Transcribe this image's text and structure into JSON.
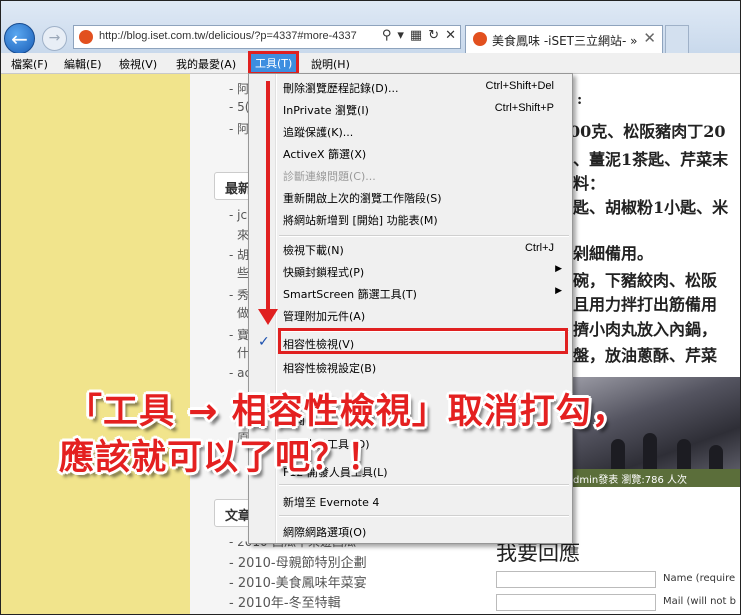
{
  "browser": {
    "url": "http://blog.iset.com.tw/delicious/?p=4337#more-4337",
    "tab_title": "美食鳳味 -iSET三立網站- »"
  },
  "menubar": {
    "items": [
      "檔案(F)",
      "編輯(E)",
      "檢視(V)",
      "我的最愛(A)",
      "工具(T)",
      "說明(H)"
    ],
    "active": "工具(T)"
  },
  "tools_menu": {
    "items": [
      {
        "label": "刪除瀏覽歷程記錄(D)...",
        "shortcut": "Ctrl+Shift+Del"
      },
      {
        "label": "InPrivate 瀏覽(I)",
        "shortcut": "Ctrl+Shift+P"
      },
      {
        "label": "追蹤保護(K)..."
      },
      {
        "label": "ActiveX 篩選(X)"
      },
      {
        "label": "診斷連線問題(C)...",
        "disabled": true
      },
      {
        "label": "重新開啟上次的瀏覽工作階段(S)"
      },
      {
        "label": "將網站新增到 [開始] 功能表(M)"
      },
      {
        "label": "檢視下載(N)",
        "shortcut": "Ctrl+J"
      },
      {
        "label": "快顯封鎖程式(P)",
        "submenu": true
      },
      {
        "label": "SmartScreen 篩選工具(T)",
        "submenu": true
      },
      {
        "label": "管理附加元件(A)"
      },
      {
        "label": "相容性檢視(V)",
        "checked": true
      },
      {
        "label": "相容性檢視設定(B)"
      },
      {
        "label": "訂閱"
      },
      {
        "label": "開發人員工具 (D)"
      },
      {
        "label": "F12 開發人員工具(L)"
      },
      {
        "label": "新增至 Evernote 4"
      },
      {
        "label": "網際網路選項(O)"
      }
    ]
  },
  "annotation": {
    "line1": "「工具 → 相容性檢視」取消打勾，",
    "line2": "應該就可以了吧？！"
  },
  "sidebar": {
    "box1": "最新",
    "box2": "文章",
    "frag": [
      "- 阿",
      "- 5(",
      "- 阿",
      "- jc",
      "來",
      "- 胡",
      "些",
      "- 秀",
      "做",
      "- 寶",
      "什",
      "- ac",
      "應",
      "原"
    ],
    "archives": [
      "- 2010-母親節特別企劃",
      "- 2010-美食鳳味年菜宴",
      "- 2010年-冬至特輯"
    ],
    "archive_partial": "- 2010-西瓜甲來遊西瓜"
  },
  "article": {
    "lines": [
      ":",
      "00克、松阪豬肉丁20",
      "、薑泥1茶匙、芹菜末",
      "料：",
      "匙、胡椒粉1小匙、米",
      "剁細備用。",
      "碗，下豬絞肉、松阪",
      "且用力拌打出筋備用",
      "擠小肉丸放入內鍋，",
      "盤，放油蔥酥、芹菜"
    ],
    "photo_caption": "dmin發表  瀏覽:786 人次"
  },
  "comment": {
    "heading": "我要回應",
    "name_label": "Name (require",
    "mail_label": "Mail (will not b"
  },
  "colors": {
    "highlight_red": "#e02020",
    "selected_blue": "#3d8ee0",
    "sidebar_yellow": "#f1e48c"
  }
}
